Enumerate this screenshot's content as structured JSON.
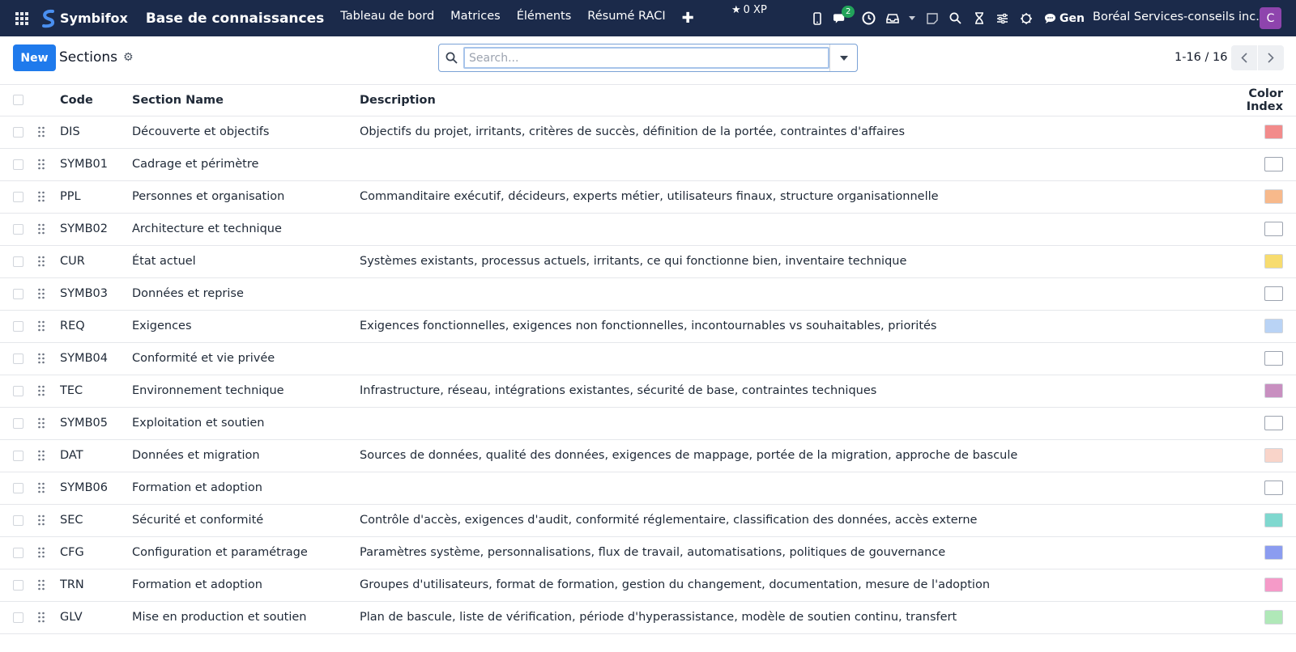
{
  "navbar": {
    "brand": "Symbifox",
    "app_title": "Base de connaissances",
    "menu": [
      "Tableau de bord",
      "Matrices",
      "Éléments",
      "Résumé RACI"
    ],
    "xp": "0 XP",
    "chat_badge": "2",
    "gen_label": "Gen",
    "company": "Boréal Services-conseils inc.",
    "avatar_initial": "C",
    "avatar_color": "#8e44ad"
  },
  "control": {
    "new_label": "New",
    "breadcrumb": "Sections",
    "search_placeholder": "Search...",
    "pager": "1-16 / 16"
  },
  "table": {
    "headers": {
      "code": "Code",
      "name": "Section Name",
      "description": "Description",
      "color": "Color Index"
    },
    "rows": [
      {
        "code": "DIS",
        "name": "Découverte et objectifs",
        "description": "Objectifs du projet, irritants, critères de succès, définition de la portée, contraintes d'affaires",
        "color": "#f28b8b"
      },
      {
        "code": "SYMB01",
        "name": "Cadrage et périmètre",
        "description": "",
        "color": "#ffffff"
      },
      {
        "code": "PPL",
        "name": "Personnes et organisation",
        "description": "Commanditaire exécutif, décideurs, experts métier, utilisateurs finaux, structure organisationnelle",
        "color": "#f7b98b"
      },
      {
        "code": "SYMB02",
        "name": "Architecture et technique",
        "description": "",
        "color": "#ffffff"
      },
      {
        "code": "CUR",
        "name": "État actuel",
        "description": "Systèmes existants, processus actuels, irritants, ce qui fonctionne bien, inventaire technique",
        "color": "#f7dc6f"
      },
      {
        "code": "SYMB03",
        "name": "Données et reprise",
        "description": "",
        "color": "#ffffff"
      },
      {
        "code": "REQ",
        "name": "Exigences",
        "description": "Exigences fonctionnelles, exigences non fonctionnelles, incontournables vs souhaitables, priorités",
        "color": "#b9d3f5"
      },
      {
        "code": "SYMB04",
        "name": "Conformité et vie privée",
        "description": "",
        "color": "#ffffff"
      },
      {
        "code": "TEC",
        "name": "Environnement technique",
        "description": "Infrastructure, réseau, intégrations existantes, sécurité de base, contraintes techniques",
        "color": "#c88fc0"
      },
      {
        "code": "SYMB05",
        "name": "Exploitation et soutien",
        "description": "",
        "color": "#ffffff"
      },
      {
        "code": "DAT",
        "name": "Données et migration",
        "description": "Sources de données, qualité des données, exigences de mappage, portée de la migration, approche de bascule",
        "color": "#f9d4c9"
      },
      {
        "code": "SYMB06",
        "name": "Formation et adoption",
        "description": "",
        "color": "#ffffff"
      },
      {
        "code": "SEC",
        "name": "Sécurité et conformité",
        "description": "Contrôle d'accès, exigences d'audit, conformité réglementaire, classification des données, accès externe",
        "color": "#7fd8cf"
      },
      {
        "code": "CFG",
        "name": "Configuration et paramétrage",
        "description": "Paramètres système, personnalisations, flux de travail, automatisations, politiques de gouvernance",
        "color": "#8b9cf0"
      },
      {
        "code": "TRN",
        "name": "Formation et adoption",
        "description": "Groupes d'utilisateurs, format de formation, gestion du changement, documentation, mesure de l'adoption",
        "color": "#f59ac8"
      },
      {
        "code": "GLV",
        "name": "Mise en production et soutien",
        "description": "Plan de bascule, liste de vérification, période d'hyperassistance, modèle de soutien continu, transfert",
        "color": "#b0e8b8"
      }
    ]
  }
}
